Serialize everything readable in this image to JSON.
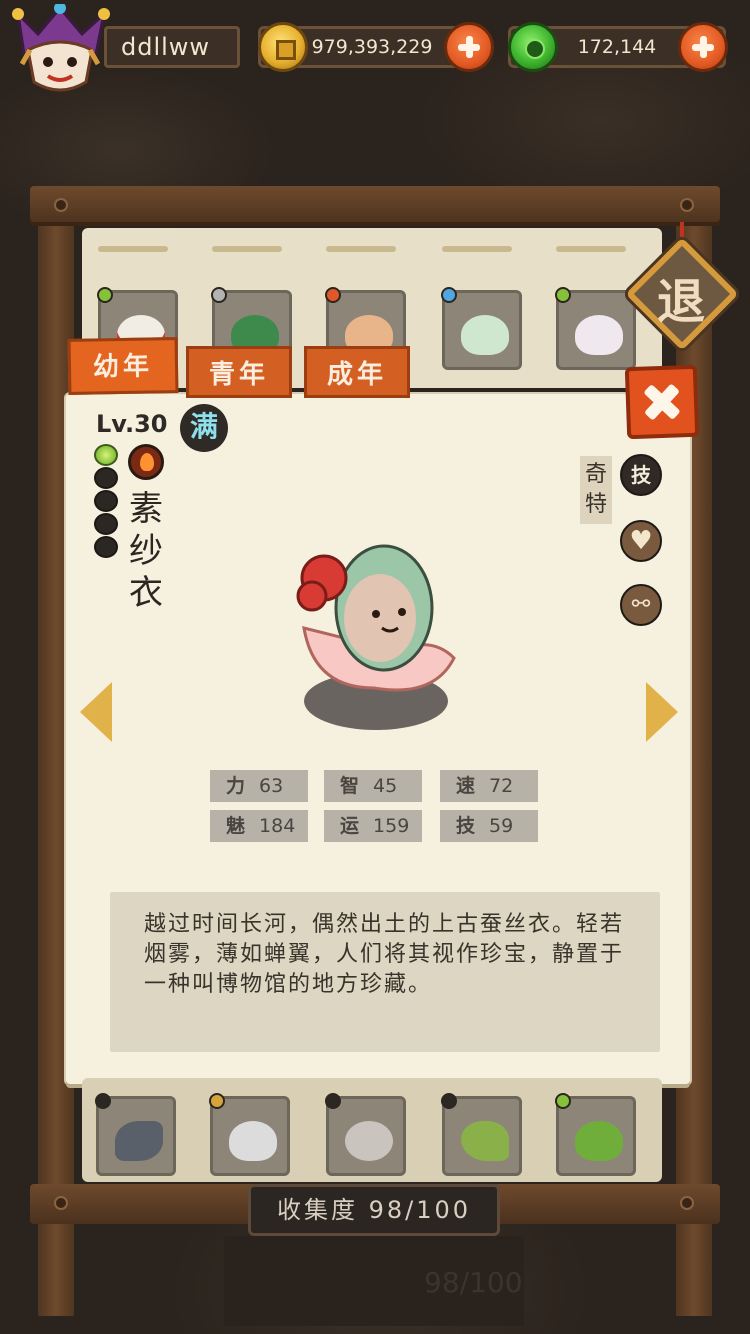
{
  "player": {
    "name": "ddllww"
  },
  "currency": {
    "gold": "979,393,229",
    "jade": "172,144"
  },
  "exit_label": "退",
  "tabs": [
    "幼年",
    "青年",
    "成年"
  ],
  "creature": {
    "level": "Lv.30",
    "full_badge": "满",
    "name_lines": [
      "素",
      "纱",
      "衣"
    ],
    "trait": "奇特",
    "skill_label": "技",
    "stars_total": 5,
    "stars_active": 1,
    "stats": [
      {
        "key": "力",
        "value": "63"
      },
      {
        "key": "智",
        "value": "45"
      },
      {
        "key": "速",
        "value": "72"
      },
      {
        "key": "魅",
        "value": "184"
      },
      {
        "key": "运",
        "value": "159"
      },
      {
        "key": "技",
        "value": "59"
      }
    ],
    "description": "越过时间长河，偶然出土的上古蚕丝衣。轻若烟雾，薄如蝉翼，人们将其视作珍宝，静置于一种叫博物馆的地方珍藏。"
  },
  "collection": {
    "label": "收集度",
    "value": "98/100",
    "ghost_value": "98/100"
  },
  "colors": {
    "tab_orange": "#d45f22",
    "close_red": "#e2521f",
    "parchment": "#f6f0df",
    "wood": "#6e4a2d"
  }
}
